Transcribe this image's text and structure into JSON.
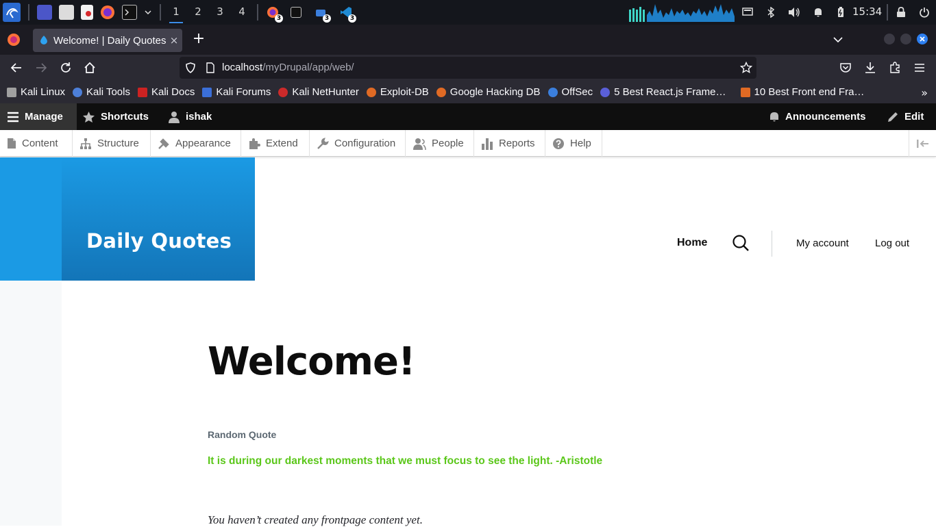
{
  "taskbar": {
    "workspaces": [
      "1",
      "2",
      "3",
      "4"
    ],
    "active_workspace": "1",
    "badges": {
      "firefox": "3",
      "files_app": "3",
      "vscode": "3"
    },
    "clock": "15:34",
    "icons": [
      "kali-menu-icon",
      "desktop-icon",
      "file-manager-icon",
      "text-editor-icon",
      "firefox-icon",
      "terminal-icon",
      "chevron-down-icon",
      "firefox-task-icon",
      "terminal-task-icon",
      "files-task-icon",
      "vscode-task-icon",
      "cpu-graph-icon",
      "network-graph-icon",
      "display-icon",
      "bluetooth-icon",
      "volume-icon",
      "notification-bell-icon",
      "battery-icon",
      "lock-icon",
      "power-icon"
    ]
  },
  "browser": {
    "tab_title": "Welcome! | Daily Quotes",
    "tab_close": "×",
    "new_tab": "+",
    "url_host": "localhost",
    "url_path": "/myDrupal/app/web/",
    "bookmarks": [
      {
        "label": "Kali Linux",
        "color": "#a0a0a0"
      },
      {
        "label": "Kali Tools",
        "color": "#4d7fd8"
      },
      {
        "label": "Kali Docs",
        "color": "#cc2222"
      },
      {
        "label": "Kali Forums",
        "color": "#3b6fd8"
      },
      {
        "label": "Kali NetHunter",
        "color": "#cc2a2a"
      },
      {
        "label": "Exploit-DB",
        "color": "#e06a24"
      },
      {
        "label": "Google Hacking DB",
        "color": "#e06a24"
      },
      {
        "label": "OffSec",
        "color": "#3b7fdd"
      },
      {
        "label": "5 Best React.js Frame…",
        "color": "#5a5fd8"
      },
      {
        "label": "10 Best Front end Fra…",
        "color": "#e06a24"
      }
    ],
    "bookmarks_more": "»"
  },
  "drupal_toolbar": {
    "manage": "Manage",
    "shortcuts": "Shortcuts",
    "user": "ishak",
    "announcements": "Announcements",
    "edit": "Edit",
    "tray": [
      "Content",
      "Structure",
      "Appearance",
      "Extend",
      "Configuration",
      "People",
      "Reports",
      "Help"
    ]
  },
  "site": {
    "name": "Daily Quotes",
    "nav_home": "Home",
    "my_account": "My account",
    "log_out": "Log out",
    "brand_color": "#1b9ae4"
  },
  "content": {
    "page_title": "Welcome!",
    "block_title": "Random Quote",
    "quote": "It is during our darkest moments that we must focus to see the light. -Aristotle",
    "quote_color": "#5bc71a",
    "empty_message": "You haven’t created any frontpage content yet."
  }
}
